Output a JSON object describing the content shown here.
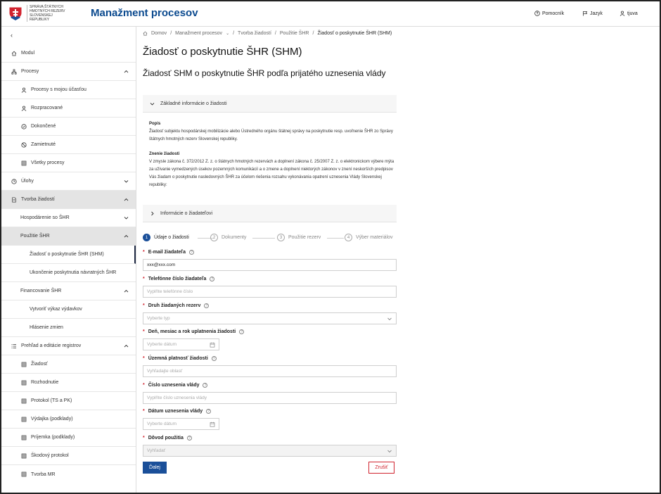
{
  "header": {
    "logo_text": "Správa štátnych hmotných rezerv Slovenskej republiky",
    "app_title": "Manažment procesov",
    "help_label": "Pomocník",
    "language_label": "Jazyk",
    "user_label": "tjuva"
  },
  "sidebar": {
    "items": [
      {
        "label": "Modul",
        "icon": "home-icon"
      },
      {
        "label": "Procesy",
        "icon": "sitemap-icon"
      },
      {
        "label": "Procesy s mojou účasťou",
        "icon": "user-icon"
      },
      {
        "label": "Rozpracované",
        "icon": "user-icon"
      },
      {
        "label": "Dokončené",
        "icon": "check-circle-icon"
      },
      {
        "label": "Zamietnuté",
        "icon": "block-icon"
      },
      {
        "label": "Všetky procesy",
        "icon": "grid-icon"
      },
      {
        "label": "Úlohy",
        "icon": "clock-icon"
      },
      {
        "label": "Tvorba žiadostí",
        "icon": "document-icon"
      },
      {
        "label": "Hospodárenie so ŠHR",
        "icon": ""
      },
      {
        "label": "Použitie ŠHR",
        "icon": ""
      },
      {
        "label": "Žiadosť o poskytnutie ŠHR (SHM)",
        "icon": ""
      },
      {
        "label": "Ukončenie poskytnutia návratných ŠHR",
        "icon": ""
      },
      {
        "label": "Financovanie ŠHR",
        "icon": ""
      },
      {
        "label": "Vytvoriť výkaz výdavkov",
        "icon": ""
      },
      {
        "label": "Hlásenie zmien",
        "icon": ""
      },
      {
        "label": "Prehľad a editácie registrov",
        "icon": "list-icon"
      },
      {
        "label": "Žiadosť",
        "icon": "grid-icon"
      },
      {
        "label": "Rozhodnutie",
        "icon": "grid-icon"
      },
      {
        "label": "Protokol (TS a PK)",
        "icon": "grid-icon"
      },
      {
        "label": "Výdajka (podklady)",
        "icon": "grid-icon"
      },
      {
        "label": "Príjemka (podklady)",
        "icon": "grid-icon"
      },
      {
        "label": "Škodový protokol",
        "icon": "grid-icon"
      },
      {
        "label": "Tvorba MR",
        "icon": "grid-icon"
      }
    ]
  },
  "breadcrumb": [
    "Domov",
    "Manažment procesov",
    "Tvorba žiadostí",
    "Použitie ŠHR",
    "Žiadosť o poskytnutie ŠHR (SHM)"
  ],
  "page_title": "Žiadosť o poskytnutie ŠHR (SHM)",
  "subtitle": "Žiadosť SHM o poskytnutie ŠHR podľa prijatého uznesenia vlády",
  "accordion": {
    "basic_info": "Základné informácie o žiadosti",
    "description_heading": "Popis",
    "description_text": "Žiadosť subjektu hospodárskej mobilizácie alebo Ústredného orgánu štátnej správy na poskytnutie resp. uvoľnenie ŠHR zo Správy štátnych hmotných rezerv Slovenskej republiky.",
    "wording_heading": "Znenie žiadosti",
    "wording_text": "V zmysle zákona č. 372/2012 Z. z. o štátnych hmotných rezervách a doplnení zákona č. 25/2007 Z. z. o elektronickom výbere mýta za užívanie vymedzených úsekov pozemných komunikácií a o zmene a doplnení niektorých zákonov v znení neskorších predpisov Vás žiadam o poskytnutie nasledovných ŠHR za účelom riešenia rozsahu vykonávania opatrení uznesenia Vlády Slovenskej republiky:",
    "applicant_info": "Informácie o žiadateľovi"
  },
  "stepper": [
    {
      "num": "1",
      "label": "Údaje o žiadosti"
    },
    {
      "num": "2",
      "label": "Dokumenty"
    },
    {
      "num": "3",
      "label": "Použitie rezerv"
    },
    {
      "num": "4",
      "label": "Výber materiálov"
    }
  ],
  "form": {
    "email_label": "E-mail žiadateľa",
    "email_value": "xxx@xxx.com",
    "phone_label": "Telefónne číslo žiadateľa",
    "phone_placeholder": "Vyplňte telefónne číslo",
    "reserve_type_label": "Druh žiadaných rezerv",
    "reserve_type_placeholder": "Vyberte typ",
    "date_label": "Deň, mesiac a rok uplatnenia žiadosti",
    "date_placeholder": "Vyberte dátum",
    "territory_label": "Územná platnosť žiadosti",
    "territory_placeholder": "Vyhľadajte oblasť",
    "resolution_label": "Číslo uznesenia vlády",
    "resolution_placeholder": "Vyplňte číslo uznesenia vlády",
    "resolution_date_label": "Dátum uznesenia vlády",
    "resolution_date_placeholder": "Vyberte dátum",
    "reason_label": "Dôvod použitia",
    "reason_placeholder": "Vyhľadať"
  },
  "buttons": {
    "next": "Ďalej",
    "cancel": "Zrušiť"
  },
  "colors": {
    "primary": "#1a4f99",
    "danger": "#d1242f",
    "title": "#0b4a8f"
  }
}
